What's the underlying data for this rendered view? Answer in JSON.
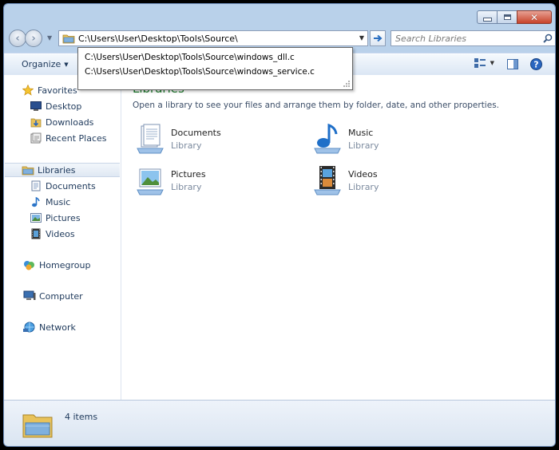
{
  "address_bar": {
    "path": "C:\\Users\\User\\Desktop\\Tools\\Source\\"
  },
  "search": {
    "placeholder": "Search Libraries"
  },
  "autocomplete": {
    "items": [
      "C:\\Users\\User\\Desktop\\Tools\\Source\\windows_dll.c",
      "C:\\Users\\User\\Desktop\\Tools\\Source\\windows_service.c"
    ]
  },
  "toolbar": {
    "organize_label": "Organize"
  },
  "nav_pane": {
    "favorites": {
      "label": "Favorites",
      "items": [
        "Desktop",
        "Downloads",
        "Recent Places"
      ]
    },
    "libraries": {
      "label": "Libraries",
      "items": [
        "Documents",
        "Music",
        "Pictures",
        "Videos"
      ]
    },
    "homegroup": "Homegroup",
    "computer": "Computer",
    "network": "Network"
  },
  "content": {
    "header": "Libraries",
    "subtitle": "Open a library to see your files and arrange them by folder, date, and other properties.",
    "libraries": [
      {
        "name": "Documents",
        "kind": "Library",
        "icon": "documents-library-icon"
      },
      {
        "name": "Music",
        "kind": "Library",
        "icon": "music-library-icon"
      },
      {
        "name": "Pictures",
        "kind": "Library",
        "icon": "pictures-library-icon"
      },
      {
        "name": "Videos",
        "kind": "Library",
        "icon": "videos-library-icon"
      }
    ]
  },
  "status_bar": {
    "item_count": "4 items"
  },
  "colors": {
    "frame": "#b9d1ea",
    "header_green": "#1c7a2b",
    "text_blue": "#1e395b",
    "close_red": "#c7432a"
  }
}
